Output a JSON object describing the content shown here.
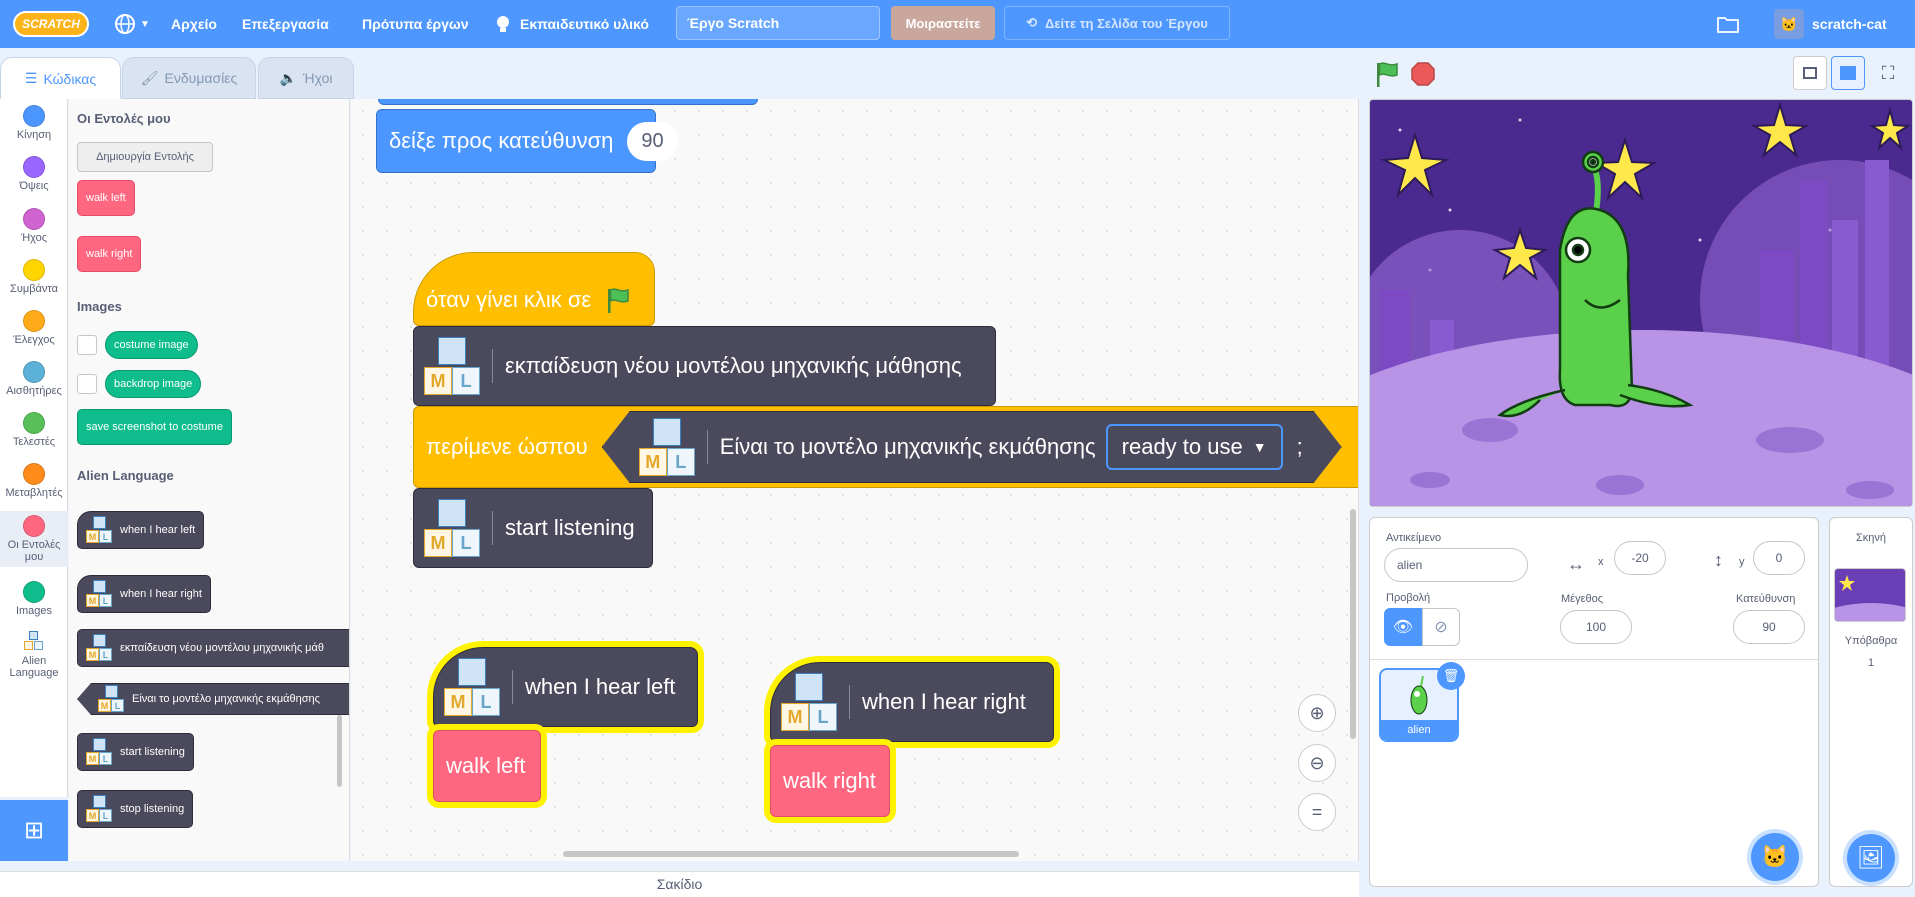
{
  "menubar": {
    "logo": "SCRATCH",
    "file": "Αρχείο",
    "edit": "Επεξεργασία",
    "tutorials": "Πρότυπα έργων",
    "learning": "Εκπαιδευτικό υλικό",
    "project_title": "Έργο Scratch",
    "share": "Μοιραστείτε",
    "see_project_page": "Δείτε τη Σελίδα του Έργου",
    "username": "scratch-cat"
  },
  "tabs": {
    "code": "Κώδικας",
    "costumes": "Ενδυμασίες",
    "sounds": "Ήχοι"
  },
  "categories": [
    {
      "label": "Κίνηση",
      "color": "#4c97ff"
    },
    {
      "label": "Όψεις",
      "color": "#9966ff"
    },
    {
      "label": "Ήχος",
      "color": "#cf63cf"
    },
    {
      "label": "Συμβάντα",
      "color": "#ffd500"
    },
    {
      "label": "Έλεγχος",
      "color": "#ffab19"
    },
    {
      "label": "Αισθητήρες",
      "color": "#5cb1d6"
    },
    {
      "label": "Τελεστές",
      "color": "#59c059"
    },
    {
      "label": "Μεταβλητές",
      "color": "#ff8c1a"
    },
    {
      "label": "Οι Εντολές μου",
      "color": "#ff6680"
    },
    {
      "label": "Images",
      "color": "#0fbd8c"
    },
    {
      "label": "Alien Language",
      "color": ""
    }
  ],
  "palette": {
    "my_blocks_title": "Οι Εντολές μου",
    "make_block": "Δημιουργία Εντολής",
    "walk_left": "walk left",
    "walk_right": "walk right",
    "images_title": "Images",
    "costume_image": "costume image",
    "backdrop_image": "backdrop image",
    "save_screenshot": "save screenshot to costume",
    "alien_title": "Alien Language",
    "when_hear_left": "when I hear left",
    "when_hear_right": "when I hear right",
    "train_model": "εκπαίδευση νέου μοντέλου μηχανικής μάθ",
    "model_status": "Είναι το μοντέλο μηχανικής εκμάθησης",
    "start_listening": "start listening",
    "stop_listening": "stop listening"
  },
  "workspace": {
    "point_direction": "δείξε προς κατεύθυνση",
    "direction_value": "90",
    "when_flag_clicked": "όταν γίνει κλικ σε",
    "train_model": "εκπαίδευση νέου μοντέλου μηχανικής μάθησης",
    "wait_until": "περίμενε ώσπου",
    "model_status": "Είναι το μοντέλο μηχανικής εκμάθησης",
    "status_option": "ready to use",
    "question_mark": ";",
    "start_listening": "start listening",
    "when_hear_left": "when I hear left",
    "walk_left": "walk left",
    "when_hear_right": "when I hear right",
    "walk_right": "walk right",
    "zoom_reset": "="
  },
  "backpack": "Σακίδιο",
  "sprite_info": {
    "sprite_label": "Αντικείμενο",
    "sprite_name": "alien",
    "x_label": "x",
    "x_value": "-20",
    "y_label": "y",
    "y_value": "0",
    "show_label": "Προβολή",
    "size_label": "Μέγεθος",
    "size_value": "100",
    "direction_label": "Κατεύθυνση",
    "direction_value": "90"
  },
  "sprites": [
    {
      "name": "alien"
    }
  ],
  "stage_pane": {
    "title": "Σκηνή",
    "backdrops_label": "Υπόβαθρα",
    "backdrops_count": "1"
  }
}
